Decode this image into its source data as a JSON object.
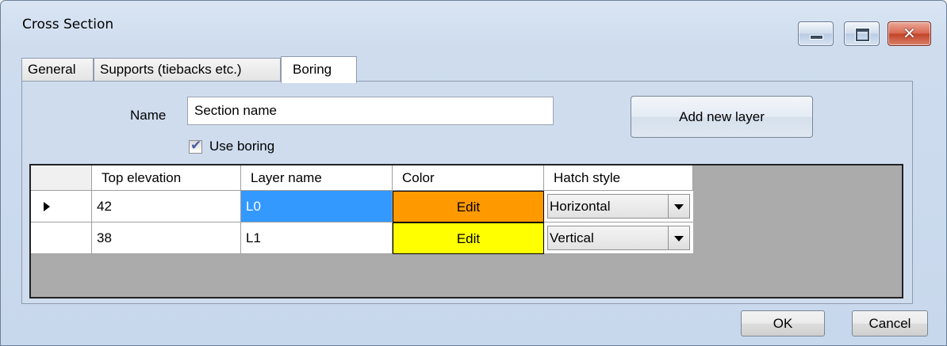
{
  "window": {
    "title": "Cross Section",
    "controls": {
      "minimize": "minimize-icon",
      "maximize": "maximize-icon",
      "close": "close-icon"
    }
  },
  "tabs": [
    {
      "label": "General",
      "active": false
    },
    {
      "label": "Supports (tiebacks etc.)",
      "active": false
    },
    {
      "label": "Boring",
      "active": true
    }
  ],
  "form": {
    "name_label": "Name",
    "name_value": "Section name",
    "use_boring_label": "Use boring",
    "use_boring_checked": true,
    "add_layer_label": "Add new layer"
  },
  "grid": {
    "columns": [
      "Top elevation",
      "Layer name",
      "Color",
      "Hatch style"
    ],
    "rows": [
      {
        "top_elevation": "42",
        "layer_name": "L0",
        "color_label": "Edit",
        "color": "#ff9900",
        "hatch": "Horizontal",
        "current": true,
        "selected_cell": "layer_name"
      },
      {
        "top_elevation": "38",
        "layer_name": "L1",
        "color_label": "Edit",
        "color": "#ffff00",
        "hatch": "Vertical",
        "current": false
      }
    ]
  },
  "footer": {
    "ok_label": "OK",
    "cancel_label": "Cancel"
  }
}
